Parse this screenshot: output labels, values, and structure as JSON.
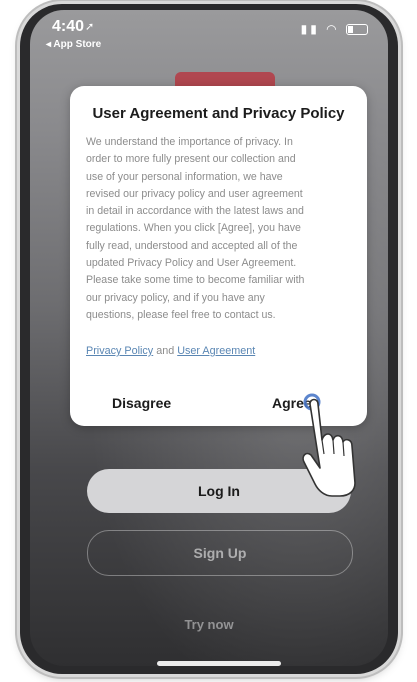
{
  "status_bar": {
    "time": "4:40",
    "back_label": "◂ App Store"
  },
  "dialog": {
    "title": "User Agreement and Privacy Policy",
    "body_lines": [
      "We understand the importance of privacy. In",
      "order to more fully present our collection and",
      "use of your personal information, we have",
      "revised our privacy policy and user agreement",
      "in detail in accordance with the latest laws and",
      "regulations. When you click [Agree], you have",
      "fully read, understood and accepted all of the",
      "updated Privacy Policy and User Agreement.",
      "Please take some time to become familiar with",
      "our privacy policy, and if you have any",
      "questions, please feel free to contact us."
    ],
    "privacy_link": "Privacy Policy",
    "and_text": " and ",
    "agreement_link": "User Agreement",
    "disagree_label": "Disagree",
    "agree_label": "Agree"
  },
  "actions": {
    "login_label": "Log In",
    "signup_label": "Sign Up",
    "try_label": "Try now"
  },
  "icons": {
    "cursor": "tap-hand-icon"
  },
  "colors": {
    "link": "#5a86b3",
    "dialog_bg": "#ffffff"
  }
}
